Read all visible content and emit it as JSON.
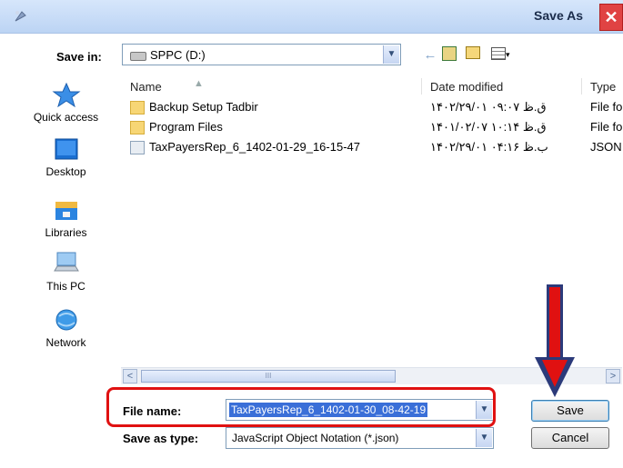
{
  "window": {
    "title": "Save As",
    "close_glyph": "✕"
  },
  "save_in": {
    "label": "Save in:",
    "value": "SPPC (D:)"
  },
  "toolbar": {
    "back_icon": "←",
    "views_caret": "▾"
  },
  "places": [
    {
      "label": "Quick access",
      "icon": "star-icon"
    },
    {
      "label": "Desktop",
      "icon": "desktop-icon"
    },
    {
      "label": "Libraries",
      "icon": "libraries-icon"
    },
    {
      "label": "This PC",
      "icon": "computer-icon"
    },
    {
      "label": "Network",
      "icon": "network-icon"
    }
  ],
  "file_list": {
    "columns": {
      "name": "Name",
      "date": "Date modified",
      "type": "Type"
    },
    "rows": [
      {
        "name": "Backup Setup Tadbir",
        "date": "۱۴۰۲/۲۹/۰۱ ق.ظ ۰۹:۰۷",
        "type": "File folder",
        "kind": "folder"
      },
      {
        "name": "Program Files",
        "date": "۱۴۰۱/۰۲/۰۷ ق.ظ ۱۰:۱۴",
        "type": "File folder",
        "kind": "folder"
      },
      {
        "name": "TaxPayersRep_6_1402-01-29_16-15-47",
        "date": "۱۴۰۲/۲۹/۰۱ ب.ظ ۰۴:۱۶",
        "type": "JSON",
        "kind": "json"
      }
    ]
  },
  "scrollbar": {
    "left": "<",
    "right": ">",
    "grip": "III"
  },
  "file_name": {
    "label": "File name:",
    "value": "TaxPayersRep_6_1402-01-30_08-42-19"
  },
  "save_as_type": {
    "label": "Save as type:",
    "value": "JavaScript Object Notation (*.json)"
  },
  "buttons": {
    "save": "Save",
    "cancel": "Cancel"
  },
  "colors": {
    "highlight": "#e01111",
    "arrow": "#e01111",
    "selection": "#3a6fd8"
  }
}
